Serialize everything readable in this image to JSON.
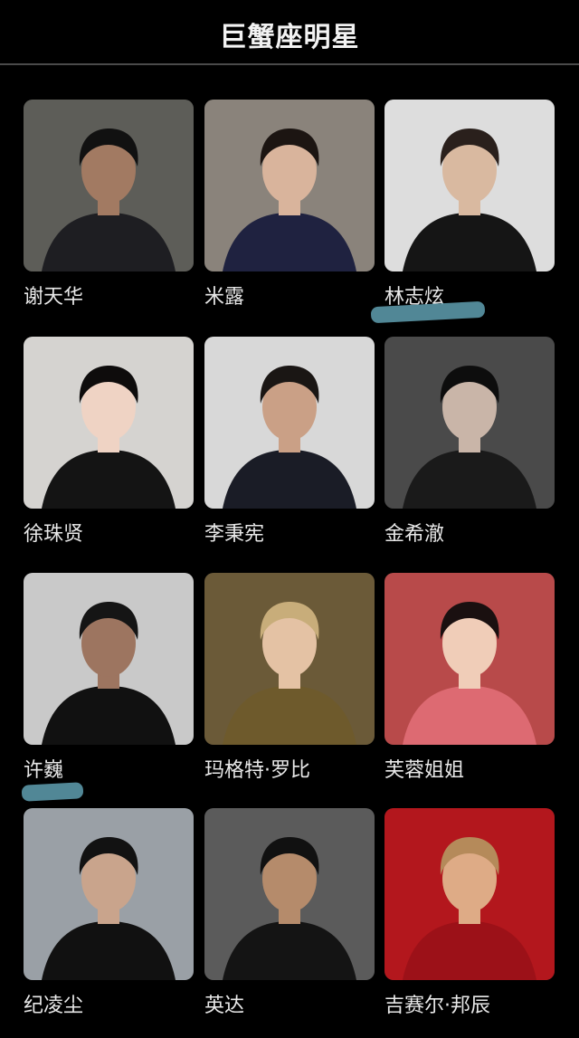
{
  "header": {
    "title": "巨蟹座明星"
  },
  "stars": [
    {
      "name": "谢天华",
      "bg": "#5d5d58",
      "hair": "#111",
      "skin": "#a27a62",
      "cloth": "#1e1e22"
    },
    {
      "name": "米露",
      "bg": "#8a837b",
      "hair": "#1c1512",
      "skin": "#d9b49c",
      "cloth": "#1f2240"
    },
    {
      "name": "林志炫",
      "bg": "#dddddd",
      "hair": "#2a201c",
      "skin": "#d9b9a0",
      "cloth": "#151515"
    },
    {
      "name": "徐珠贤",
      "bg": "#d5d3d0",
      "hair": "#0e0c0c",
      "skin": "#efd3c4",
      "cloth": "#141414"
    },
    {
      "name": "李秉宪",
      "bg": "#d8d8d8",
      "hair": "#1a1614",
      "skin": "#caa086",
      "cloth": "#1a1c26"
    },
    {
      "name": "金希澈",
      "bg": "#4a4a4a",
      "hair": "#0d0d0d",
      "skin": "#c9b5a8",
      "cloth": "#1a1a1a"
    },
    {
      "name": "许巍",
      "bg": "#c9c9c9",
      "hair": "#151515",
      "skin": "#9d7560",
      "cloth": "#111"
    },
    {
      "name": "玛格特·罗比",
      "bg": "#6b5a38",
      "hair": "#c8ad7a",
      "skin": "#e4c2a4",
      "cloth": "#6e5a2c"
    },
    {
      "name": "芙蓉姐姐",
      "bg": "#b84a4a",
      "hair": "#1a1010",
      "skin": "#f0cdb8",
      "cloth": "#dd6a72"
    },
    {
      "name": "纪凌尘",
      "bg": "#9aa0a6",
      "hair": "#121212",
      "skin": "#c9a48c",
      "cloth": "#111"
    },
    {
      "name": "英达",
      "bg": "#5b5b5b",
      "hair": "#111",
      "skin": "#b58b6b",
      "cloth": "#141414"
    },
    {
      "name": "吉赛尔·邦辰",
      "bg": "#b3171d",
      "hair": "#b58a5a",
      "skin": "#deab86",
      "cloth": "#9c1118"
    }
  ]
}
